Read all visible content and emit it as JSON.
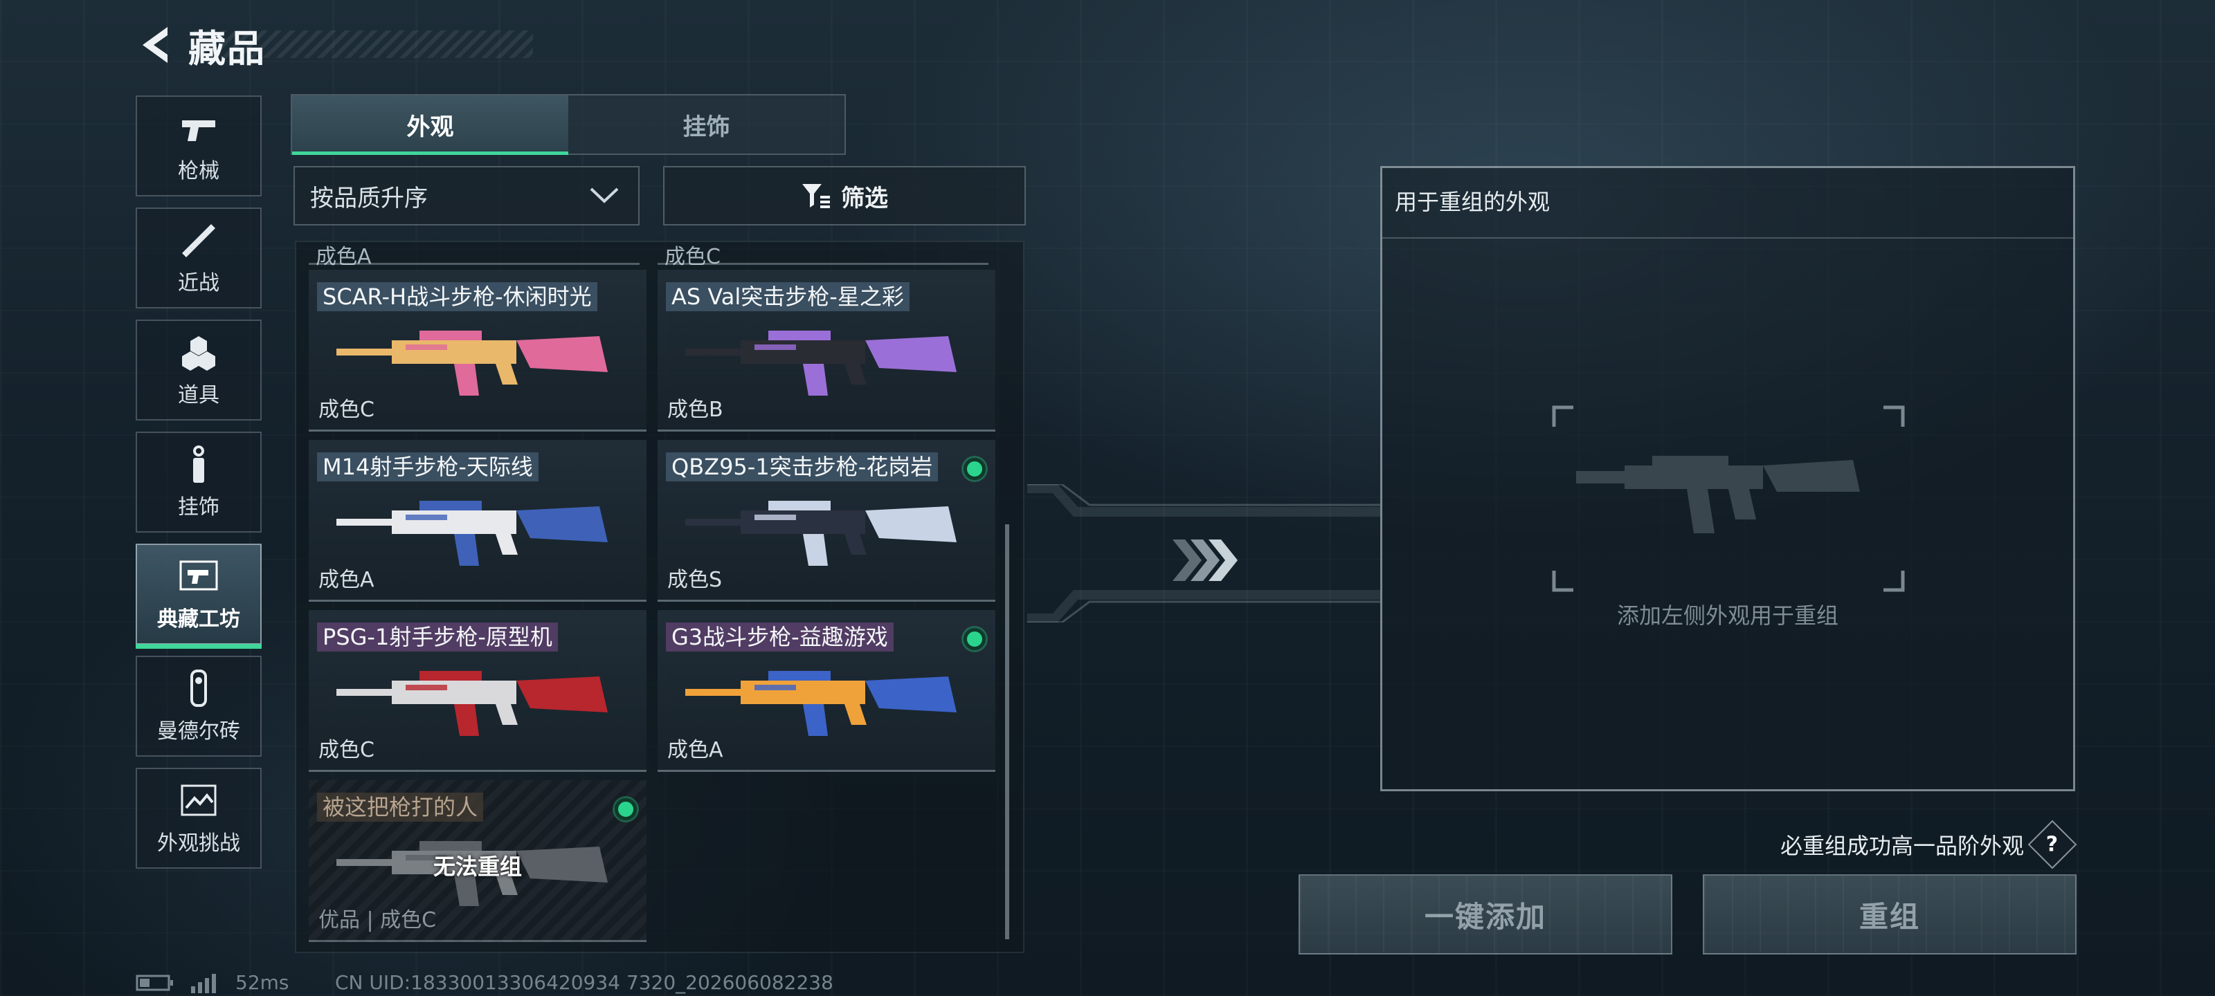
{
  "header": {
    "title": "藏品"
  },
  "nav": [
    {
      "label": "枪械",
      "icon": "pistol-icon",
      "active": false
    },
    {
      "label": "近战",
      "icon": "knife-icon",
      "active": false
    },
    {
      "label": "道具",
      "icon": "grenades-icon",
      "active": false
    },
    {
      "label": "挂饰",
      "icon": "charm-icon",
      "active": false
    },
    {
      "label": "典藏工坊",
      "icon": "workshop-icon",
      "active": true
    },
    {
      "label": "曼德尔砖",
      "icon": "brick-icon",
      "active": false
    },
    {
      "label": "外观挑战",
      "icon": "challenge-icon",
      "active": false
    }
  ],
  "tabs": [
    {
      "label": "外观",
      "active": true
    },
    {
      "label": "挂饰",
      "active": false
    }
  ],
  "sort": {
    "label": "按品质升序"
  },
  "filter": {
    "label": "筛选"
  },
  "partial_row": [
    "成色A",
    "成色C"
  ],
  "items": [
    {
      "name": "SCAR-H战斗步枪-休闲时光",
      "grade": "成色C",
      "new": false,
      "name_style": "blue",
      "gun_colors": [
        "#e9b86a",
        "#e06a9a"
      ]
    },
    {
      "name": "AS Val突击步枪-星之彩",
      "grade": "成色B",
      "new": false,
      "name_style": "blue",
      "gun_colors": [
        "#2a2c33",
        "#9b6fd8"
      ]
    },
    {
      "name": "M14射手步枪-天际线",
      "grade": "成色A",
      "new": false,
      "name_style": "blue",
      "gun_colors": [
        "#e8e9ec",
        "#3f62b8"
      ]
    },
    {
      "name": "QBZ95-1突击步枪-花岗岩",
      "grade": "成色S",
      "new": true,
      "name_style": "blue",
      "gun_colors": [
        "#2a3140",
        "#c9d3e6"
      ]
    },
    {
      "name": "PSG-1射手步枪-原型机",
      "grade": "成色C",
      "new": false,
      "name_style": "purple",
      "gun_colors": [
        "#d9d9dc",
        "#b8262e"
      ]
    },
    {
      "name": "G3战斗步枪-益趣游戏",
      "grade": "成色A",
      "new": true,
      "name_style": "purple",
      "gun_colors": [
        "#f0a23a",
        "#3c63c8"
      ]
    },
    {
      "name": "被这把枪打的人",
      "grade": "优品 | 成色C",
      "new": true,
      "name_style": "dim",
      "disabled": true,
      "disabled_text": "无法重组",
      "gun_colors": [
        "#7a7f84",
        "#5a6066"
      ]
    }
  ],
  "recombine": {
    "header": "用于重组的外观",
    "hint": "添加左侧外观用于重组"
  },
  "guarantee": {
    "text": "必重组成功高一品阶外观",
    "help": "?"
  },
  "buttons": {
    "add_all": "一键添加",
    "recombine": "重组"
  },
  "footer": {
    "ping": "52ms",
    "uid": "CN UID:18330013306420934 7320_202606082238"
  },
  "colors": {
    "accent": "#3fd79a",
    "new_dot": "#2bd48d"
  }
}
